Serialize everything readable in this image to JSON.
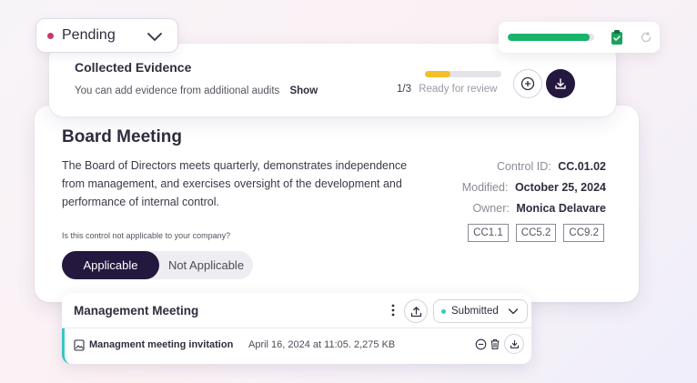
{
  "pending_dropdown": {
    "label": "Pending",
    "dot_color": "#c9386b",
    "icon": "chevron-down-icon"
  },
  "status_widget": {
    "progress_fraction": 0.95,
    "bar_color": "#18b46b",
    "icons": [
      "clipboard-check-icon",
      "refresh-icon"
    ]
  },
  "evidence": {
    "title": "Collected Evidence",
    "subtitle": "You can add evidence from additional audits",
    "show_link": "Show",
    "count": "1/3",
    "status": "Ready for review",
    "progress_fraction": 0.33,
    "progress_color": "#f2be2a",
    "icons": [
      "add-icon",
      "download-icon"
    ]
  },
  "control": {
    "title": "Board Meeting",
    "description": "The Board of Directors meets quarterly, demonstrates independence from management, and exercises oversight of the development and performance of internal control.",
    "control_id_label": "Control ID:",
    "control_id": "CC.01.02",
    "modified_label": "Modified:",
    "modified": "October 25, 2024",
    "owner_label": "Owner:",
    "owner": "Monica Delavare",
    "tags": [
      "CC1.1",
      "CC5.2",
      "CC9.2"
    ],
    "applicability_question": "Is this control not applicable to your company?",
    "applicability_options": [
      "Applicable",
      "Not Applicable"
    ],
    "applicability_selected": "Applicable",
    "accent_color": "#24183f"
  },
  "management": {
    "title": "Management Meeting",
    "status": "Submitted",
    "status_dot_color": "#38c6c4",
    "file": {
      "name": "Managment meeting invitation",
      "details": "April 16, 2024 at 11:05. 2,275 KB"
    },
    "icons": [
      "kebab-menu-icon",
      "upload-icon",
      "chevron-down-icon",
      "file-image-icon",
      "remove-icon",
      "trash-icon",
      "download-icon"
    ]
  }
}
